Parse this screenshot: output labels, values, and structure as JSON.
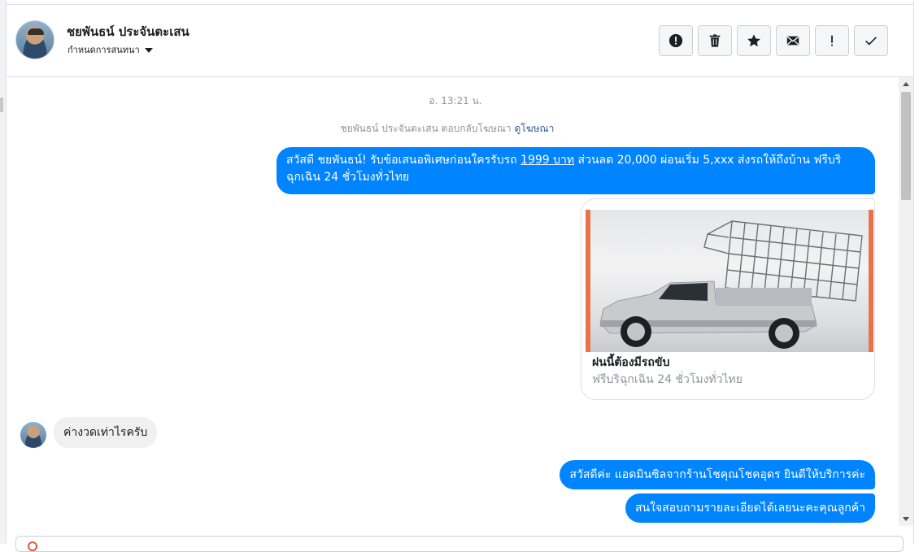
{
  "header": {
    "contact_name": "ชยพันธน์ ประจันตะเสน",
    "conversation_settings_label": "กำหนดการสนทนา",
    "actions": [
      {
        "name": "report-spam-button",
        "icon": "exclamation-circle-icon"
      },
      {
        "name": "delete-button",
        "icon": "trash-icon"
      },
      {
        "name": "star-button",
        "icon": "star-icon"
      },
      {
        "name": "mark-unread-button",
        "icon": "envelope-icon"
      },
      {
        "name": "follow-up-button",
        "icon": "exclamation-icon"
      },
      {
        "name": "mark-done-button",
        "icon": "checkmark-icon"
      }
    ]
  },
  "conversation": {
    "timestamp": "อ. 13:21 น.",
    "reply_note": {
      "text": "ชยพันธน์ ประจันตะเสน ตอบกลับโฆษณา",
      "link": "ดูโฆษณา"
    },
    "ad_message": {
      "part1": "สวัสดี ชยพันธน์! รับข้อเสนอพิเศษก่อนใครรับรถ ",
      "price_link": "1999 บาท",
      "part2": " ส่วนลด 20,000  ผ่อนเริ่ม 5,xxx ส่งรถให้ถึงบ้าน ฟรีบริฉุกเฉิน 24 ชั่วโมงทั่วไทย"
    },
    "ad_card": {
      "title": "ฝนนี้ต้องมีรถขับ",
      "subtitle": "ฟรีบริฉุกเฉิน 24 ชั่วโมงทั่วไทย"
    },
    "incoming_message": "ค่างวดเท่าไรครับ",
    "outgoing_messages": [
      "สวัสดีค่ะ แอดมินซิลจากร้านโชคุณโชคอุดร ยินดีให้บริการค่ะ",
      "สนใจสอบถามรายละเอียดได้เลยนะคะคุณลูกค้า"
    ]
  },
  "colors": {
    "outgoing_bubble": "#0084ff",
    "incoming_bubble": "#f1f0f0",
    "link": "#385898"
  }
}
